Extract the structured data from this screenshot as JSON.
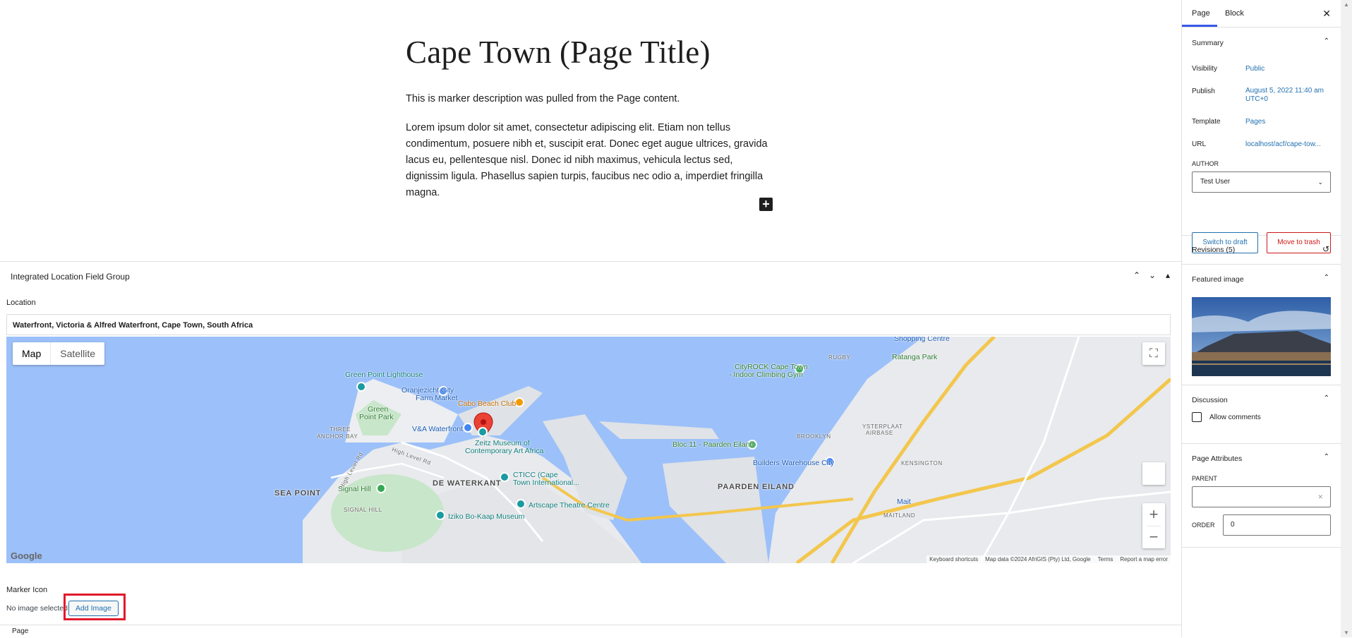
{
  "editor": {
    "title": "Cape Town (Page Title)",
    "paragraph1": "This is marker description was pulled from the Page content.",
    "paragraph2": "Lorem ipsum dolor sit amet, consectetur adipiscing elit. Etiam non tellus condimentum, posuere nibh et, suscipit erat. Donec eget augue ultrices, gravida lacus eu, pellentesque nisl. Donec id nibh maximus, vehicula lectus sed, dignissim ligula. Phasellus sapien turpis, faucibus nec odio a, imperdiet fringilla magna.",
    "inserter_symbol": "+"
  },
  "metabox": {
    "title": "Integrated Location Field Group",
    "location_label": "Location",
    "location_value": "Waterfront, Victoria & Alfred Waterfront, Cape Town, South Africa",
    "marker_icon_label": "Marker Icon",
    "no_image_text": "No image selected",
    "add_image_label": "Add Image"
  },
  "map": {
    "type_map": "Map",
    "type_satellite": "Satellite",
    "google": "Google",
    "attribution": [
      "Keyboard shortcuts",
      "Map data ©2024 AfriGIS (Pty) Ltd, Google",
      "Terms",
      "Report a map error"
    ],
    "labels": {
      "green_point_lighthouse": "Green Point Lighthouse",
      "oranjezicht_1": "Oranjezicht City",
      "oranjezicht_2": "Farm Market",
      "cabo": "Cabo Beach Club",
      "green_point_1": "Green",
      "green_point_2": "Point Park",
      "va_waterfront": "V&A Waterfront",
      "zeitz_1": "Zeitz Museum of",
      "zeitz_2": "Contemporary Art Africa",
      "three_anchor_1": "THREE",
      "three_anchor_2": "ANCHOR BAY",
      "high_level_rd": "High Level Rd",
      "high_level_rd2": "High Level Rd",
      "ctic_1": "CTICC (Cape",
      "ctic_2": "Town International...",
      "de_waterkant": "DE WATERKANT",
      "sea_point": "SEA POINT",
      "signal_hill": "Signal Hill",
      "signal_hill_caps": "SIGNAL HILL",
      "artscape": "Artscape Theatre Centre",
      "iziko": "Iziko Bo-Kaap Museum",
      "cityrock_1": "CityROCK Cape Town",
      "cityrock_2": "- Indoor Climbing Gym",
      "rugby": "RUGBY",
      "ratanga": "Ratanga Park",
      "shopping": "Shopping Centre",
      "ysterplaat_1": "YSTERPLAAT",
      "ysterplaat_2": "AIRBASE",
      "brooklyn": "BROOKLYN",
      "bloc11": "Bloc 11 - Paarden Eiland",
      "builders": "Builders Warehouse City",
      "kensington": "KENSINGTON",
      "paarden_eiland": "PAARDEN EILAND",
      "maitland": "MAITLAND",
      "mait": "Mait"
    }
  },
  "footer": {
    "breadcrumb": "Page"
  },
  "sidebar": {
    "tab_page": "Page",
    "tab_block": "Block",
    "summary": {
      "title": "Summary",
      "visibility_label": "Visibility",
      "visibility_value": "Public",
      "publish_label": "Publish",
      "publish_value": "August 5, 2022 11:40 am UTC+0",
      "template_label": "Template",
      "template_value": "Pages",
      "url_label": "URL",
      "url_value": "localhost/acf/cape-tow...",
      "author_label": "AUTHOR",
      "author_value": "Test User",
      "switch_draft": "Switch to draft",
      "move_trash": "Move to trash"
    },
    "revisions": "Revisions (5)",
    "featured_image": "Featured image",
    "discussion": {
      "title": "Discussion",
      "allow_comments": "Allow comments"
    },
    "page_attributes": {
      "title": "Page Attributes",
      "parent_label": "PARENT",
      "order_label": "ORDER",
      "order_value": "0"
    }
  },
  "colors": {
    "accent": "#2271b1",
    "danger": "#cc1818",
    "water": "#9cc0f9",
    "tab_underline": "#3858e9",
    "highlight": "#e11a2b"
  }
}
